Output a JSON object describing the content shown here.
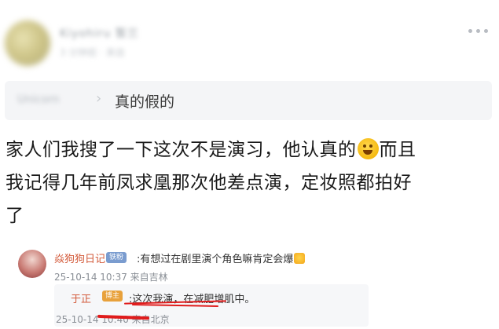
{
  "post": {
    "author": {
      "name_blurred": "Kiyohiru 暂兰",
      "time_blurred": "3 分钟前 · 来自"
    },
    "quote": {
      "source_blurred": "Unicorn",
      "text": "真的假的"
    },
    "body": {
      "line1_a": "家人们我搜了一下这次不是演习，他认真的",
      "emoji": "rolling-on-floor-laughing",
      "line1_b": "而且",
      "line2": "我记得几年前凤求凰那次他差点演，定妆照都拍好",
      "line3": "了"
    }
  },
  "comment": {
    "name": "焱狗狗日记",
    "badge": "铁粉",
    "text": ":有想过在剧里演个角色嘛肯定会爆",
    "meta": "25-10-14 10:37 来自吉林"
  },
  "reply": {
    "name": "于正",
    "badge": "博主",
    "text": ":这次我演，在减肥增肌中。",
    "meta": "25-10-14 10:40 来自北京"
  },
  "colors": {
    "accent_red": "#e01b1b",
    "name_orange": "#d35a3a"
  }
}
